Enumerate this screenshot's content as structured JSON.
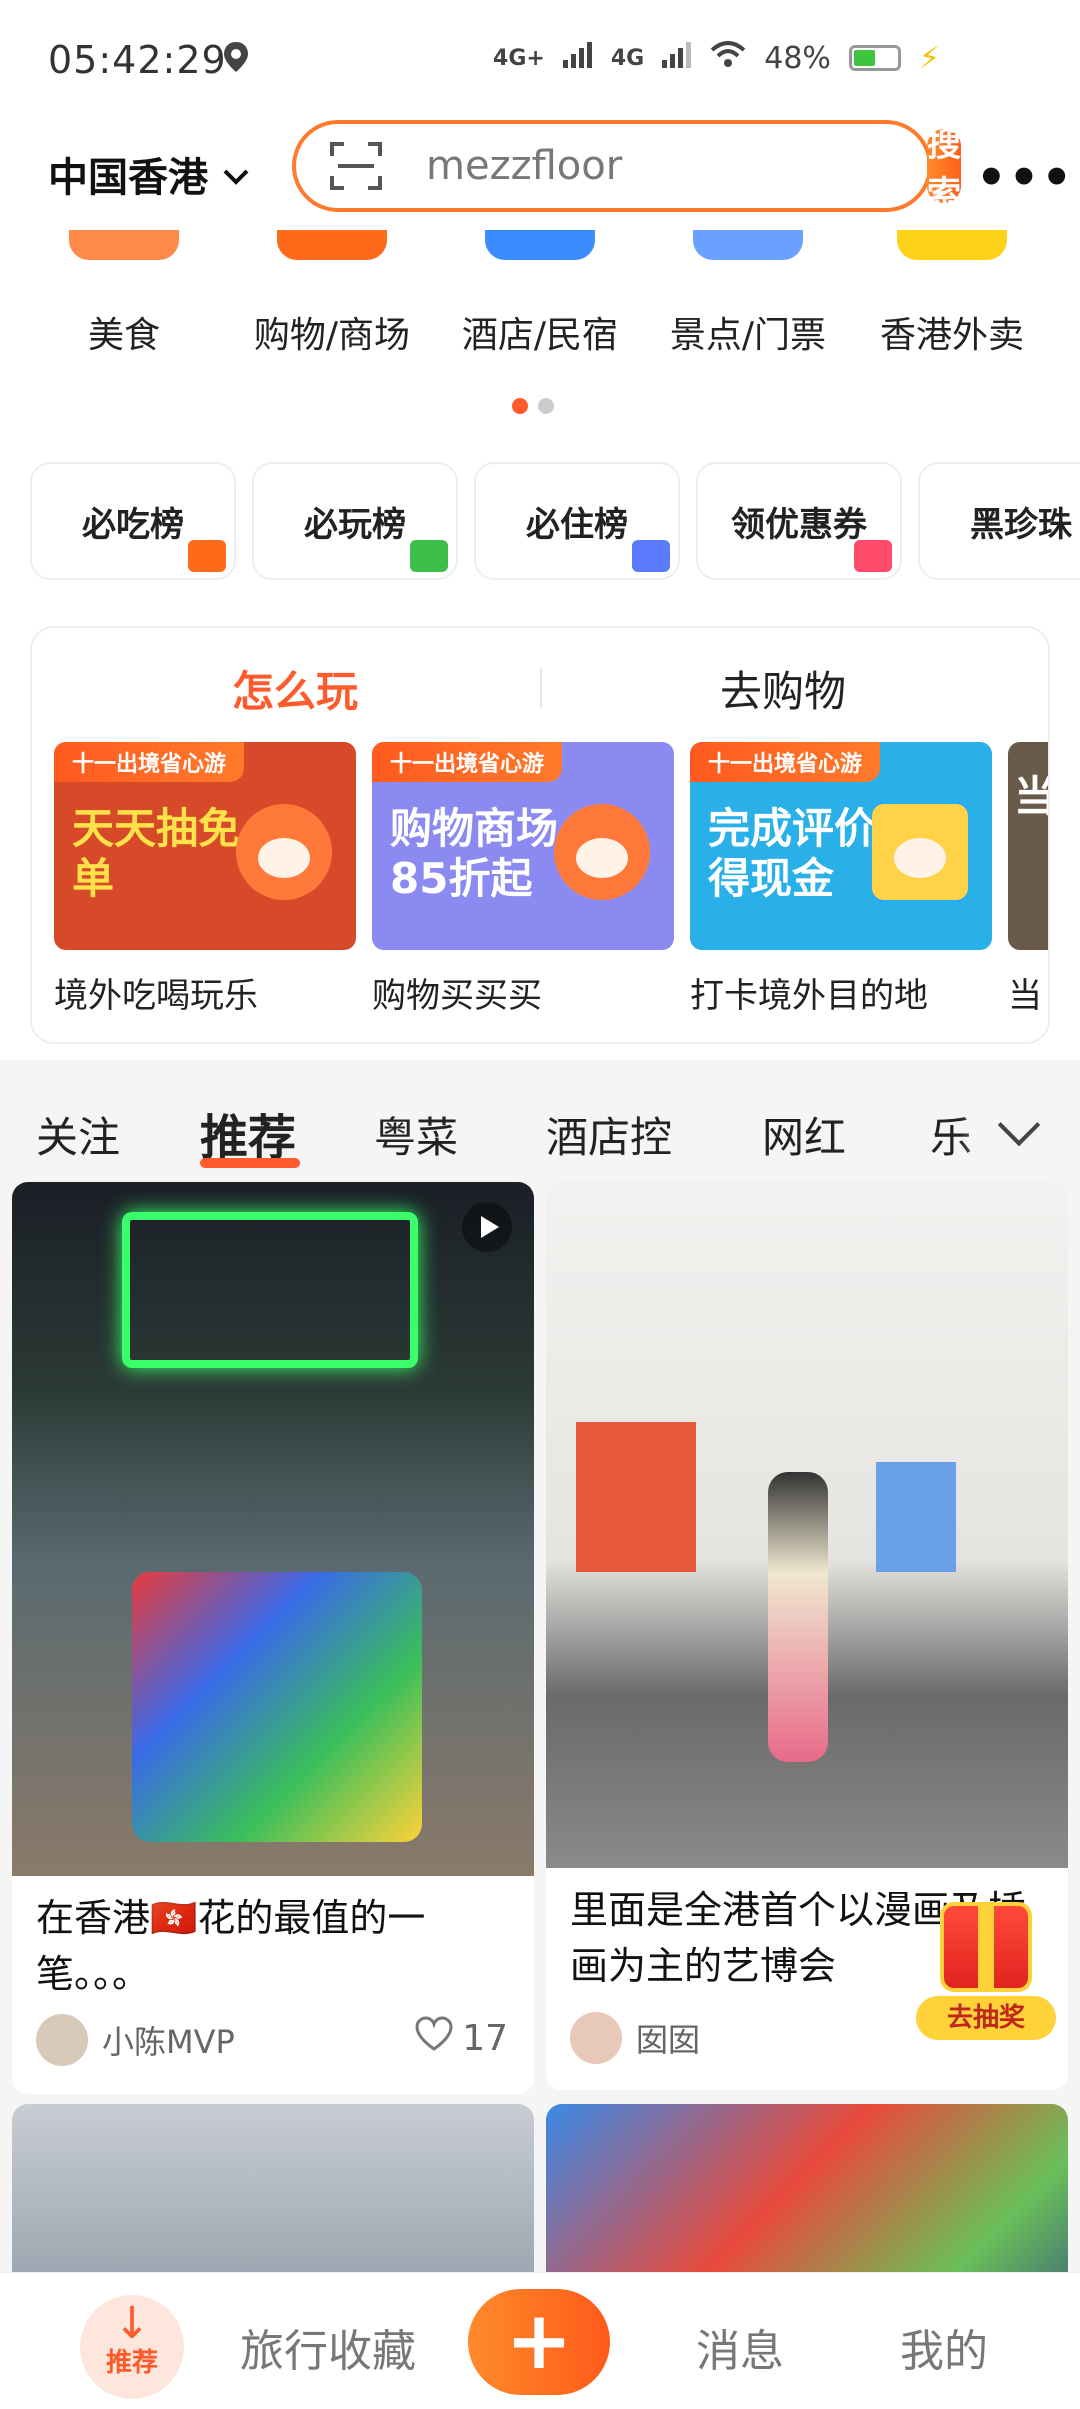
{
  "status_bar": {
    "time": "05:42:29",
    "network_1": "4G+",
    "network_2": "4G",
    "battery": "48%"
  },
  "header": {
    "region": "中国香港",
    "search_value": "mezzfloor",
    "search_button": "搜索"
  },
  "categories": [
    {
      "label": "美食",
      "icon": "food-icon",
      "color": "#ff8a4a"
    },
    {
      "label": "购物/商场",
      "icon": "shopping-icon",
      "color": "#ff6a1a"
    },
    {
      "label": "酒店/民宿",
      "icon": "hotel-icon",
      "color": "#3a8cff"
    },
    {
      "label": "景点/门票",
      "icon": "attraction-icon",
      "color": "#6aa0ff"
    },
    {
      "label": "香港外卖",
      "icon": "delivery-icon",
      "color": "#ffd21a"
    }
  ],
  "rank_chips": [
    {
      "label": "必吃榜",
      "deco": "#ff6a1a"
    },
    {
      "label": "必玩榜",
      "deco": "#3bbf4a"
    },
    {
      "label": "必住榜",
      "deco": "#5a7aff"
    },
    {
      "label": "领优惠券",
      "deco": "#ff4a6a"
    },
    {
      "label": "黑珍珠",
      "deco": "#222222"
    }
  ],
  "activity": {
    "tab_active": "怎么玩",
    "tab_inactive": "去购物",
    "promos": [
      {
        "tag": "十一出境省心游",
        "headline": "天天抽免单",
        "caption": "境外吃喝玩乐",
        "bg": "#d64a2a",
        "text_color": "#ffe14a"
      },
      {
        "tag": "十一出境省心游",
        "headline": "购物商场85折起",
        "caption": "购物买买买",
        "bg": "#8a8af0",
        "text_color": "#ffffff"
      },
      {
        "tag": "十一出境省心游",
        "headline": "完成评价得现金",
        "caption": "打卡境外目的地",
        "bg": "#2ab0e8",
        "text_color": "#ffffff"
      },
      {
        "tag": "",
        "headline": "当",
        "caption": "当",
        "bg": "#6a5a4a",
        "text_color": "#ffffff"
      }
    ]
  },
  "feed_tabs": [
    "关注",
    "推荐",
    "粤菜",
    "酒店控",
    "网红",
    "乐"
  ],
  "feed": [
    {
      "title": "在香港🇭🇰花的最值的一笔。。。",
      "author": "小陈MVP",
      "likes": "17"
    },
    {
      "title": "里面是全港首个以漫画及插画为主的艺博会",
      "author": "囡囡",
      "likes": ""
    }
  ],
  "gift": {
    "label": "去抽奖"
  },
  "bottom_nav": {
    "home": "推荐",
    "favorites": "旅行收藏",
    "plus": "+",
    "messages": "消息",
    "mine": "我的"
  }
}
